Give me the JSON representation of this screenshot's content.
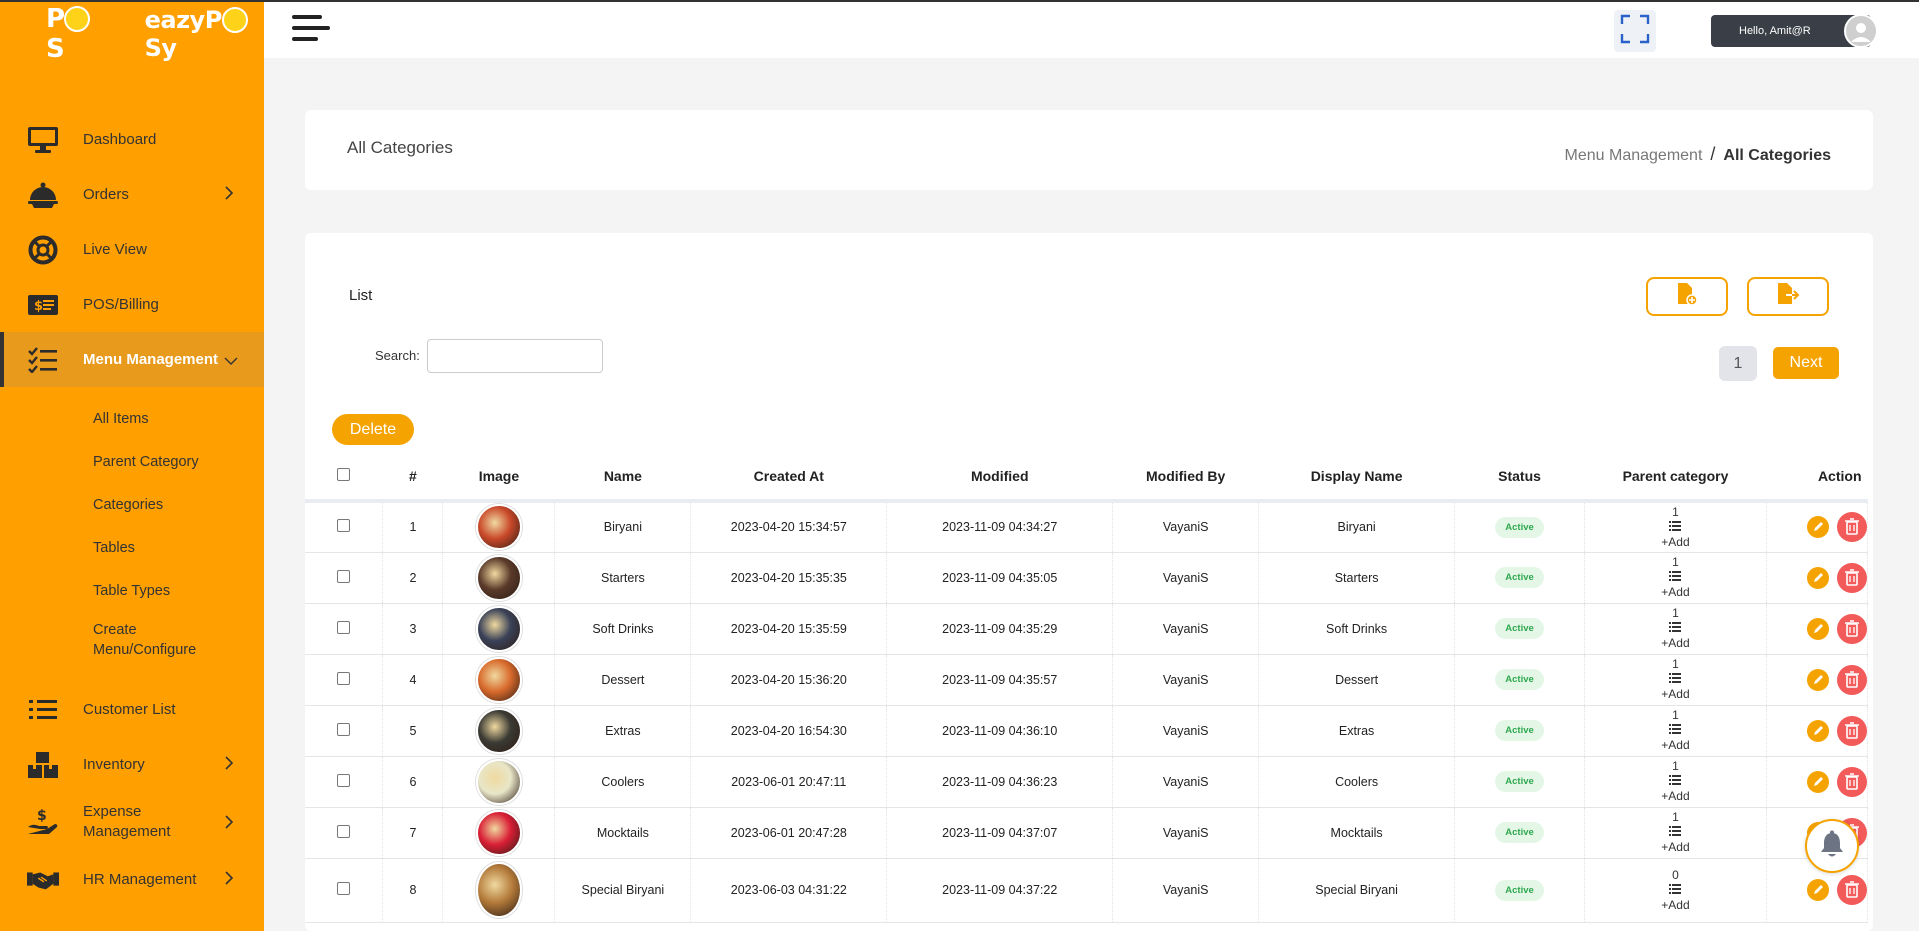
{
  "brand": {
    "pos_logo": "POS",
    "name": "eazyPOSy"
  },
  "nav": {
    "items": [
      {
        "label": "Dashboard",
        "icon": "monitor-icon"
      },
      {
        "label": "Orders",
        "icon": "cloche-icon"
      },
      {
        "label": "Live View",
        "icon": "lifebuoy-icon"
      },
      {
        "label": "POS/Billing",
        "icon": "cash-icon"
      },
      {
        "label": "Menu Management",
        "icon": "checklist-icon"
      }
    ],
    "submenu": [
      "All Items",
      "Parent Category",
      "Categories",
      "Tables",
      "Table Types",
      "Create Menu/Configure"
    ],
    "items_after": [
      {
        "label": "Customer List",
        "icon": "list-icon"
      },
      {
        "label": "Inventory",
        "icon": "boxes-icon"
      },
      {
        "label": "Expense Management",
        "icon": "hand-money-icon"
      },
      {
        "label": "HR Management",
        "icon": "handshake-icon"
      }
    ]
  },
  "topbar": {
    "greeting": "Hello, Amit@R"
  },
  "header": {
    "title": "All Categories",
    "breadcrumb": {
      "parent": "Menu Management",
      "separator": "/",
      "current": "All Categories"
    }
  },
  "list": {
    "title": "List",
    "search_label": "Search:",
    "search_value": "",
    "page": "1",
    "next_label": "Next",
    "delete_label": "Delete",
    "columns": [
      "#",
      "Image",
      "Name",
      "Created At",
      "Modified",
      "Modified By",
      "Display Name",
      "Status",
      "Parent category",
      "Action"
    ],
    "add_label": "+Add",
    "rows": [
      {
        "n": "1",
        "name": "Biryani",
        "created": "2023-04-20 15:34:57",
        "modified": "2023-11-09 04:34:27",
        "by": "VayaniS",
        "display": "Biryani",
        "status": "Active",
        "parent_count": "1",
        "img_color": "#c9482a"
      },
      {
        "n": "2",
        "name": "Starters",
        "created": "2023-04-20 15:35:35",
        "modified": "2023-11-09 04:35:05",
        "by": "VayaniS",
        "display": "Starters",
        "status": "Active",
        "parent_count": "1",
        "img_color": "#5a3a2a"
      },
      {
        "n": "3",
        "name": "Soft Drinks",
        "created": "2023-04-20 15:35:59",
        "modified": "2023-11-09 04:35:29",
        "by": "VayaniS",
        "display": "Soft Drinks",
        "status": "Active",
        "parent_count": "1",
        "img_color": "#3a4258"
      },
      {
        "n": "4",
        "name": "Dessert",
        "created": "2023-04-20 15:36:20",
        "modified": "2023-11-09 04:35:57",
        "by": "VayaniS",
        "display": "Dessert",
        "status": "Active",
        "parent_count": "1",
        "img_color": "#d86a2c"
      },
      {
        "n": "5",
        "name": "Extras",
        "created": "2023-04-20 16:54:30",
        "modified": "2023-11-09 04:36:10",
        "by": "VayaniS",
        "display": "Extras",
        "status": "Active",
        "parent_count": "1",
        "img_color": "#3b3a34"
      },
      {
        "n": "6",
        "name": "Coolers",
        "created": "2023-06-01 20:47:11",
        "modified": "2023-11-09 04:36:23",
        "by": "VayaniS",
        "display": "Coolers",
        "status": "Active",
        "parent_count": "1",
        "img_color": "#e8e6c8"
      },
      {
        "n": "7",
        "name": "Mocktails",
        "created": "2023-06-01 20:47:28",
        "modified": "2023-11-09 04:37:07",
        "by": "VayaniS",
        "display": "Mocktails",
        "status": "Active",
        "parent_count": "1",
        "img_color": "#d91e35"
      },
      {
        "n": "8",
        "name": "Special Biryani",
        "created": "2023-06-03 04:31:22",
        "modified": "2023-11-09 04:37:22",
        "by": "VayaniS",
        "display": "Special Biryani",
        "status": "Active",
        "parent_count": "0",
        "img_color": "#b37a3a"
      }
    ]
  },
  "colors": {
    "accent": "#f5a300",
    "sidebar": "#ff9f00",
    "active_nav": "#e89a1c",
    "danger": "#f35a5a",
    "success": "#2fa84f"
  }
}
